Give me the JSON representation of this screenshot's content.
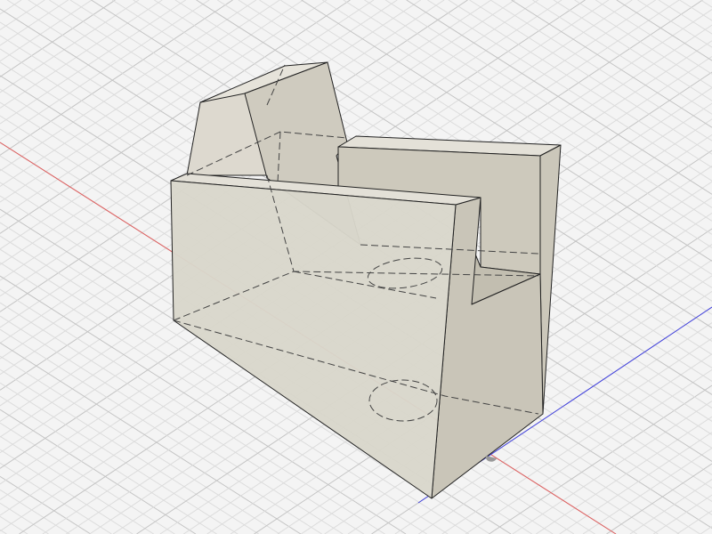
{
  "viewport": {
    "name": "3d-cad-viewport",
    "colors": {
      "background": "#f4f4f4",
      "grid_minor": "#dcdcdc",
      "grid_major": "#c4c4c4",
      "x_axis": "#e06060",
      "y_axis": "#4040e0",
      "body_face": "#d9d6cb",
      "body_face_dark": "#c7c3b6",
      "body_face_light": "#e2dfd6",
      "edge": "#222222",
      "hidden_edge": "#444444"
    },
    "icons": [
      "origin-icon"
    ]
  }
}
